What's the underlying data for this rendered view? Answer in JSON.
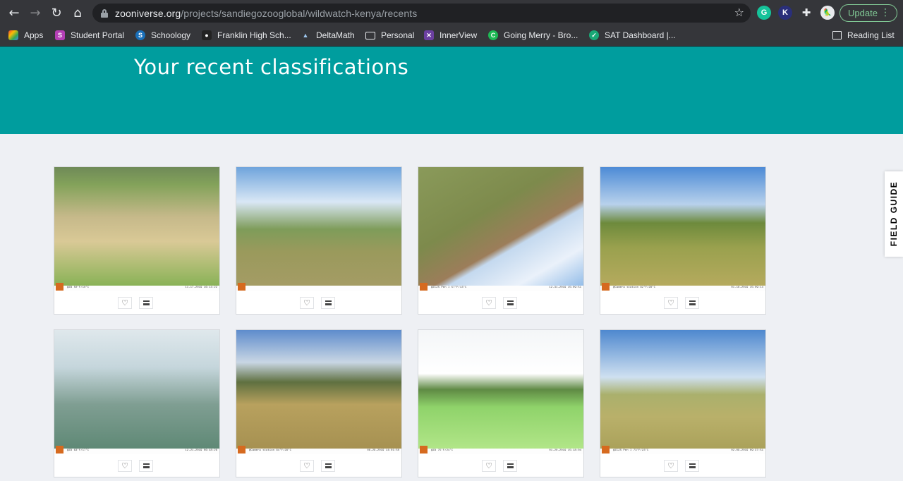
{
  "browser": {
    "url_host": "zooniverse.org",
    "url_path": "/projects/sandiegozooglobal/wildwatch-kenya/recents",
    "update_label": "Update",
    "extensions": {
      "grammarly": "G",
      "k": "K",
      "puzzle": "✚",
      "avatar": "🦜"
    }
  },
  "bookmarks": {
    "items": [
      {
        "label": "Apps"
      },
      {
        "label": "Student Portal"
      },
      {
        "label": "Schoology"
      },
      {
        "label": "Franklin High Sch..."
      },
      {
        "label": "DeltaMath"
      },
      {
        "label": "Personal"
      },
      {
        "label": "InnerView"
      },
      {
        "label": "Going Merry - Bro..."
      },
      {
        "label": "SAT Dashboard |..."
      },
      {
        "label": "Reading List"
      }
    ]
  },
  "page": {
    "title": "Your recent classifications",
    "field_guide_label": "FIELD GUIDE"
  },
  "classifications": [
    {
      "scene": "s1",
      "stamp_text": "@ZB  50°F/10°C",
      "time": "11-17-2019 16:14:22"
    },
    {
      "scene": "s2",
      "stamp_text": "",
      "time": ""
    },
    {
      "scene": "s3",
      "stamp_text": "@ZCZS  Pen I  57°F/13°C",
      "time": "12-31-2019 15:09:51"
    },
    {
      "scene": "s4",
      "stamp_text": "@Camera station  82°F/28°C",
      "time": "01-16-2019 15:09:14"
    },
    {
      "scene": "s5",
      "stamp_text": "@Z8  63°F/17°C",
      "time": "12-21-2019 06:48:26"
    },
    {
      "scene": "s6",
      "stamp_text": "@Camera station  84°F/29°C",
      "time": "06-29-2019 14:01:50"
    },
    {
      "scene": "s7",
      "stamp_text": "@Z8  75°F/24°C",
      "time": "01-20-2019 15:18:04"
    },
    {
      "scene": "s8",
      "stamp_text": "@ZCZS  Pen I  73°F/23°C",
      "time": "02-09-2019 09:37:51"
    }
  ]
}
